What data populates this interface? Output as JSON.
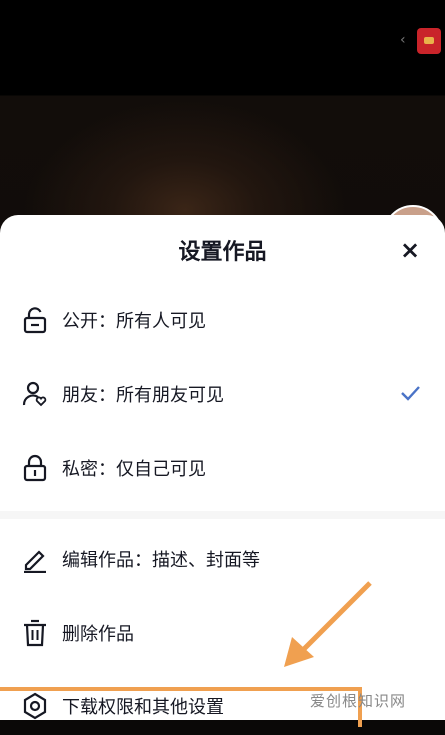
{
  "sheet": {
    "title": "设置作品",
    "close_label": "×"
  },
  "visibility_options": [
    {
      "label": "公开：所有人可见",
      "icon": "unlock-icon",
      "selected": false
    },
    {
      "label": "朋友：所有朋友可见",
      "icon": "friends-icon",
      "selected": true
    },
    {
      "label": "私密：仅自己可见",
      "icon": "lock-icon",
      "selected": false
    }
  ],
  "actions": [
    {
      "label": "编辑作品：描述、封面等",
      "icon": "edit-icon"
    },
    {
      "label": "删除作品",
      "icon": "trash-icon"
    },
    {
      "label": "下载权限和其他设置",
      "icon": "settings-icon"
    }
  ],
  "colors": {
    "accent_check": "#4a73c7",
    "highlight": "#f0a050"
  },
  "watermark": "爱创根知识网"
}
